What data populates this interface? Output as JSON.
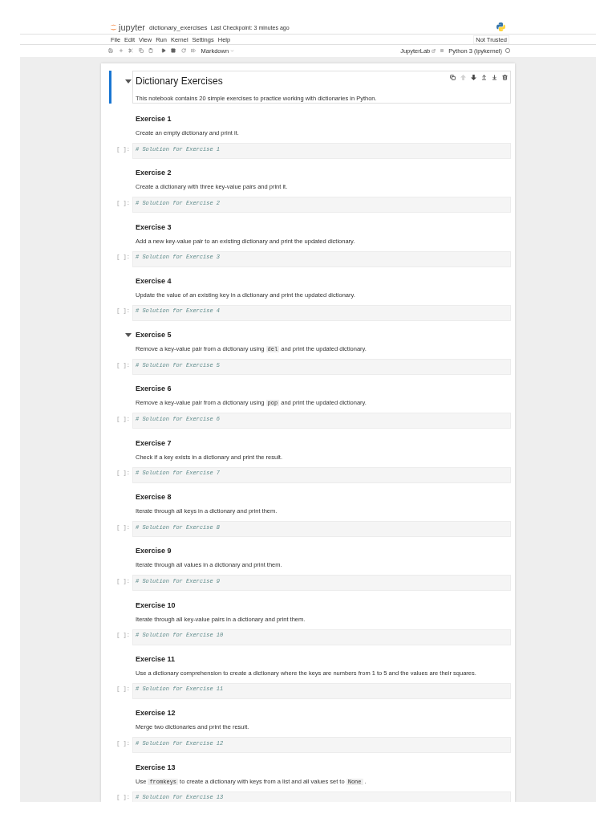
{
  "header": {
    "logo_text": "jupyter",
    "notebook_name": "dictionary_exercises",
    "checkpoint": "Last Checkpoint: 3 minutes ago"
  },
  "menu": {
    "items": [
      "File",
      "Edit",
      "View",
      "Run",
      "Kernel",
      "Settings",
      "Help"
    ],
    "trust_status": "Not Trusted"
  },
  "toolbar": {
    "cell_type": "Markdown",
    "open_in": "JupyterLab",
    "kernel": "Python 3 (ipykernel)",
    "kernel_busy": false
  },
  "cells": [
    {
      "kind": "title",
      "selected": true,
      "heading": "Dictionary Exercises",
      "parts": [
        {
          "kind": "text",
          "text": "This notebook contains 20 simple exercises to practice working with dictionaries in Python."
        }
      ],
      "toolbar": [
        {
          "kind": "duplicate",
          "disabled": false
        },
        {
          "kind": "move-up",
          "disabled": true
        },
        {
          "kind": "move-down",
          "disabled": false
        },
        {
          "kind": "insert-above",
          "disabled": false
        },
        {
          "kind": "insert-below",
          "disabled": false
        },
        {
          "kind": "delete",
          "disabled": false
        }
      ]
    },
    {
      "kind": "exercise",
      "selected": false,
      "hovered": false,
      "heading": "Exercise 1",
      "parts": [
        {
          "kind": "text",
          "text": "Create an empty dictionary and print it."
        }
      ],
      "prompt": "[ ]:",
      "code": "# Solution for Exercise 1"
    },
    {
      "kind": "exercise",
      "selected": false,
      "hovered": false,
      "heading": "Exercise 2",
      "parts": [
        {
          "kind": "text",
          "text": "Create a dictionary with three key-value pairs and print it."
        }
      ],
      "prompt": "[ ]:",
      "code": "# Solution for Exercise 2"
    },
    {
      "kind": "exercise",
      "selected": false,
      "hovered": false,
      "heading": "Exercise 3",
      "parts": [
        {
          "kind": "text",
          "text": "Add a new key-value pair to an existing dictionary and print the updated dictionary."
        }
      ],
      "prompt": "[ ]:",
      "code": "# Solution for Exercise 3"
    },
    {
      "kind": "exercise",
      "selected": false,
      "hovered": false,
      "heading": "Exercise 4",
      "parts": [
        {
          "kind": "text",
          "text": "Update the value of an existing key in a dictionary and print the updated dictionary."
        }
      ],
      "prompt": "[ ]:",
      "code": "# Solution for Exercise 4"
    },
    {
      "kind": "exercise",
      "selected": false,
      "hovered": true,
      "heading": "Exercise 5",
      "parts": [
        {
          "kind": "text",
          "text": "Remove a key-value pair from a dictionary using "
        },
        {
          "kind": "code",
          "text": "del"
        },
        {
          "kind": "text",
          "text": " and print the updated dictionary."
        }
      ],
      "prompt": "[ ]:",
      "code": "# Solution for Exercise 5"
    },
    {
      "kind": "exercise",
      "selected": false,
      "hovered": false,
      "heading": "Exercise 6",
      "parts": [
        {
          "kind": "text",
          "text": "Remove a key-value pair from a dictionary using "
        },
        {
          "kind": "code",
          "text": "pop"
        },
        {
          "kind": "text",
          "text": " and print the updated dictionary."
        }
      ],
      "prompt": "[ ]:",
      "code": "# Solution for Exercise 6"
    },
    {
      "kind": "exercise",
      "selected": false,
      "hovered": false,
      "heading": "Exercise 7",
      "parts": [
        {
          "kind": "text",
          "text": "Check if a key exists in a dictionary and print the result."
        }
      ],
      "prompt": "[ ]:",
      "code": "# Solution for Exercise 7"
    },
    {
      "kind": "exercise",
      "selected": false,
      "hovered": false,
      "heading": "Exercise 8",
      "parts": [
        {
          "kind": "text",
          "text": "Iterate through all keys in a dictionary and print them."
        }
      ],
      "prompt": "[ ]:",
      "code": "# Solution for Exercise 8"
    },
    {
      "kind": "exercise",
      "selected": false,
      "hovered": false,
      "heading": "Exercise 9",
      "parts": [
        {
          "kind": "text",
          "text": "Iterate through all values in a dictionary and print them."
        }
      ],
      "prompt": "[ ]:",
      "code": "# Solution for Exercise 9"
    },
    {
      "kind": "exercise",
      "selected": false,
      "hovered": false,
      "heading": "Exercise 10",
      "parts": [
        {
          "kind": "text",
          "text": "Iterate through all key-value pairs in a dictionary and print them."
        }
      ],
      "prompt": "[ ]:",
      "code": "# Solution for Exercise 10"
    },
    {
      "kind": "exercise",
      "selected": false,
      "hovered": false,
      "heading": "Exercise 11",
      "parts": [
        {
          "kind": "text",
          "text": "Use a dictionary comprehension to create a dictionary where the keys are numbers from 1 to 5 and the values are their squares."
        }
      ],
      "prompt": "[ ]:",
      "code": "# Solution for Exercise 11"
    },
    {
      "kind": "exercise",
      "selected": false,
      "hovered": false,
      "heading": "Exercise 12",
      "parts": [
        {
          "kind": "text",
          "text": "Merge two dictionaries and print the result."
        }
      ],
      "prompt": "[ ]:",
      "code": "# Solution for Exercise 12"
    },
    {
      "kind": "exercise",
      "selected": false,
      "hovered": false,
      "heading": "Exercise 13",
      "parts": [
        {
          "kind": "text",
          "text": "Use "
        },
        {
          "kind": "code",
          "text": "fromkeys"
        },
        {
          "kind": "text",
          "text": " to create a dictionary with keys from a list and all values set to "
        },
        {
          "kind": "code",
          "text": "None"
        },
        {
          "kind": "text",
          "text": " ."
        }
      ],
      "prompt": "[ ]:",
      "code": "# Solution for Exercise 13"
    }
  ]
}
